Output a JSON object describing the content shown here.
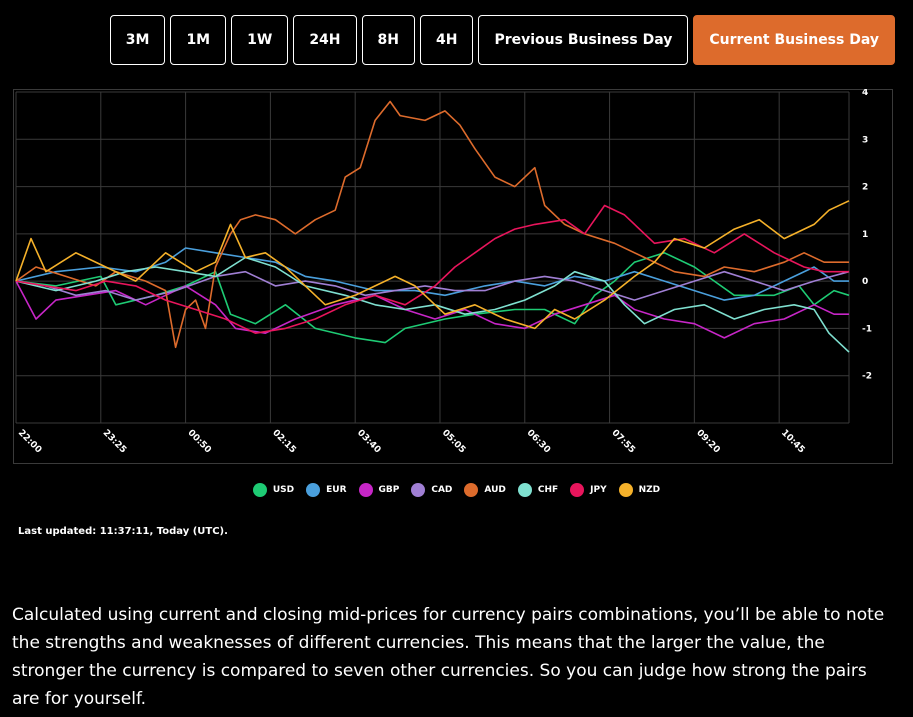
{
  "tabs": [
    {
      "label": "3M",
      "active": false
    },
    {
      "label": "1M",
      "active": false
    },
    {
      "label": "1W",
      "active": false
    },
    {
      "label": "24H",
      "active": false
    },
    {
      "label": "8H",
      "active": false
    },
    {
      "label": "4H",
      "active": false
    },
    {
      "label": "Previous Business Day",
      "active": false
    },
    {
      "label": "Current Business Day",
      "active": true
    }
  ],
  "colors": {
    "accent": "#dd6b2c",
    "background": "#000000",
    "grid": "#3a3a3a"
  },
  "chart_data": {
    "type": "line",
    "title": "",
    "xlabel": "",
    "ylabel": "",
    "x_tick_labels": [
      "22:00",
      "23:25",
      "00:50",
      "02:15",
      "03:40",
      "05:05",
      "06:30",
      "07:55",
      "09:20",
      "10:45"
    ],
    "x_range_minutes": [
      0,
      835
    ],
    "ylim": [
      -3,
      4
    ],
    "y_ticks": [
      4,
      3,
      2,
      1,
      0,
      -1,
      -2
    ],
    "grid": true,
    "legend_position": "bottom",
    "series": [
      {
        "name": "USD",
        "color": "#1ecb74",
        "points": [
          [
            0,
            0
          ],
          [
            40,
            -0.1
          ],
          [
            85,
            0.1
          ],
          [
            100,
            -0.5
          ],
          [
            140,
            -0.3
          ],
          [
            170,
            -0.1
          ],
          [
            200,
            0.2
          ],
          [
            215,
            -0.7
          ],
          [
            240,
            -0.9
          ],
          [
            270,
            -0.5
          ],
          [
            300,
            -1
          ],
          [
            340,
            -1.2
          ],
          [
            370,
            -1.3
          ],
          [
            390,
            -1
          ],
          [
            430,
            -0.8
          ],
          [
            460,
            -0.7
          ],
          [
            500,
            -0.6
          ],
          [
            530,
            -0.6
          ],
          [
            560,
            -0.9
          ],
          [
            580,
            -0.3
          ],
          [
            600,
            0
          ],
          [
            620,
            0.4
          ],
          [
            650,
            0.6
          ],
          [
            680,
            0.3
          ],
          [
            700,
            0
          ],
          [
            720,
            -0.3
          ],
          [
            760,
            -0.3
          ],
          [
            785,
            -0.1
          ],
          [
            800,
            -0.5
          ],
          [
            820,
            -0.2
          ],
          [
            835,
            -0.3
          ]
        ]
      },
      {
        "name": "EUR",
        "color": "#4a9fdc",
        "points": [
          [
            0,
            0
          ],
          [
            40,
            0.2
          ],
          [
            85,
            0.3
          ],
          [
            120,
            0.2
          ],
          [
            150,
            0.4
          ],
          [
            170,
            0.7
          ],
          [
            200,
            0.6
          ],
          [
            230,
            0.5
          ],
          [
            260,
            0.4
          ],
          [
            290,
            0.1
          ],
          [
            320,
            0
          ],
          [
            360,
            -0.2
          ],
          [
            400,
            -0.2
          ],
          [
            430,
            -0.3
          ],
          [
            470,
            -0.1
          ],
          [
            500,
            0
          ],
          [
            530,
            -0.1
          ],
          [
            560,
            0.1
          ],
          [
            590,
            0
          ],
          [
            620,
            0.2
          ],
          [
            650,
            0
          ],
          [
            680,
            -0.2
          ],
          [
            710,
            -0.4
          ],
          [
            740,
            -0.3
          ],
          [
            770,
            0
          ],
          [
            800,
            0.3
          ],
          [
            820,
            0
          ],
          [
            835,
            0
          ]
        ]
      },
      {
        "name": "GBP",
        "color": "#c726c7",
        "points": [
          [
            0,
            0
          ],
          [
            20,
            -0.8
          ],
          [
            40,
            -0.4
          ],
          [
            70,
            -0.3
          ],
          [
            100,
            -0.2
          ],
          [
            130,
            -0.5
          ],
          [
            150,
            -0.3
          ],
          [
            170,
            -0.1
          ],
          [
            200,
            -0.5
          ],
          [
            220,
            -1
          ],
          [
            250,
            -1.1
          ],
          [
            280,
            -0.8
          ],
          [
            320,
            -0.5
          ],
          [
            360,
            -0.3
          ],
          [
            390,
            -0.6
          ],
          [
            420,
            -0.8
          ],
          [
            450,
            -0.6
          ],
          [
            480,
            -0.9
          ],
          [
            510,
            -1
          ],
          [
            540,
            -0.7
          ],
          [
            570,
            -0.5
          ],
          [
            600,
            -0.3
          ],
          [
            620,
            -0.6
          ],
          [
            650,
            -0.8
          ],
          [
            680,
            -0.9
          ],
          [
            710,
            -1.2
          ],
          [
            740,
            -0.9
          ],
          [
            770,
            -0.8
          ],
          [
            800,
            -0.5
          ],
          [
            820,
            -0.7
          ],
          [
            835,
            -0.7
          ]
        ]
      },
      {
        "name": "CAD",
        "color": "#a07fd4",
        "points": [
          [
            0,
            0
          ],
          [
            30,
            -0.1
          ],
          [
            60,
            -0.3
          ],
          [
            90,
            -0.2
          ],
          [
            120,
            -0.4
          ],
          [
            160,
            -0.2
          ],
          [
            200,
            0.1
          ],
          [
            230,
            0.2
          ],
          [
            260,
            -0.1
          ],
          [
            290,
            0
          ],
          [
            320,
            -0.1
          ],
          [
            350,
            -0.3
          ],
          [
            380,
            -0.2
          ],
          [
            410,
            -0.1
          ],
          [
            440,
            -0.2
          ],
          [
            470,
            -0.2
          ],
          [
            500,
            0
          ],
          [
            530,
            0.1
          ],
          [
            560,
            0
          ],
          [
            590,
            -0.2
          ],
          [
            620,
            -0.4
          ],
          [
            650,
            -0.2
          ],
          [
            680,
            0
          ],
          [
            710,
            0.2
          ],
          [
            740,
            0
          ],
          [
            770,
            -0.2
          ],
          [
            800,
            0
          ],
          [
            835,
            0.2
          ]
        ]
      },
      {
        "name": "AUD",
        "color": "#dd6b2c",
        "points": [
          [
            0,
            0
          ],
          [
            20,
            0.3
          ],
          [
            50,
            0.1
          ],
          [
            80,
            -0.1
          ],
          [
            100,
            0.2
          ],
          [
            130,
            0
          ],
          [
            150,
            -0.2
          ],
          [
            160,
            -1.4
          ],
          [
            170,
            -0.6
          ],
          [
            180,
            -0.4
          ],
          [
            190,
            -1
          ],
          [
            200,
            0.3
          ],
          [
            215,
            1
          ],
          [
            225,
            1.3
          ],
          [
            240,
            1.4
          ],
          [
            260,
            1.3
          ],
          [
            280,
            1
          ],
          [
            300,
            1.3
          ],
          [
            320,
            1.5
          ],
          [
            330,
            2.2
          ],
          [
            345,
            2.4
          ],
          [
            360,
            3.4
          ],
          [
            375,
            3.8
          ],
          [
            385,
            3.5
          ],
          [
            410,
            3.4
          ],
          [
            430,
            3.6
          ],
          [
            445,
            3.3
          ],
          [
            460,
            2.8
          ],
          [
            480,
            2.2
          ],
          [
            500,
            2
          ],
          [
            520,
            2.4
          ],
          [
            530,
            1.6
          ],
          [
            550,
            1.2
          ],
          [
            570,
            1
          ],
          [
            600,
            0.8
          ],
          [
            630,
            0.5
          ],
          [
            660,
            0.2
          ],
          [
            690,
            0.1
          ],
          [
            710,
            0.3
          ],
          [
            740,
            0.2
          ],
          [
            770,
            0.4
          ],
          [
            790,
            0.6
          ],
          [
            810,
            0.4
          ],
          [
            835,
            0.4
          ]
        ]
      },
      {
        "name": "CHF",
        "color": "#7fe0d0",
        "points": [
          [
            0,
            0
          ],
          [
            40,
            -0.2
          ],
          [
            80,
            0
          ],
          [
            110,
            0.2
          ],
          [
            140,
            0.3
          ],
          [
            170,
            0.2
          ],
          [
            200,
            0.1
          ],
          [
            230,
            0.5
          ],
          [
            260,
            0.3
          ],
          [
            290,
            -0.1
          ],
          [
            330,
            -0.3
          ],
          [
            360,
            -0.5
          ],
          [
            390,
            -0.6
          ],
          [
            420,
            -0.5
          ],
          [
            450,
            -0.7
          ],
          [
            480,
            -0.6
          ],
          [
            510,
            -0.4
          ],
          [
            540,
            -0.1
          ],
          [
            560,
            0.2
          ],
          [
            590,
            0
          ],
          [
            610,
            -0.5
          ],
          [
            630,
            -0.9
          ],
          [
            660,
            -0.6
          ],
          [
            690,
            -0.5
          ],
          [
            720,
            -0.8
          ],
          [
            750,
            -0.6
          ],
          [
            780,
            -0.5
          ],
          [
            800,
            -0.6
          ],
          [
            815,
            -1.1
          ],
          [
            835,
            -1.5
          ]
        ]
      },
      {
        "name": "JPY",
        "color": "#e8155c",
        "points": [
          [
            0,
            0
          ],
          [
            30,
            -0.1
          ],
          [
            60,
            -0.2
          ],
          [
            90,
            0
          ],
          [
            120,
            -0.1
          ],
          [
            150,
            -0.4
          ],
          [
            180,
            -0.6
          ],
          [
            210,
            -0.8
          ],
          [
            240,
            -1.1
          ],
          [
            270,
            -1
          ],
          [
            300,
            -0.8
          ],
          [
            330,
            -0.5
          ],
          [
            360,
            -0.3
          ],
          [
            390,
            -0.5
          ],
          [
            420,
            -0.1
          ],
          [
            440,
            0.3
          ],
          [
            460,
            0.6
          ],
          [
            480,
            0.9
          ],
          [
            500,
            1.1
          ],
          [
            520,
            1.2
          ],
          [
            550,
            1.3
          ],
          [
            570,
            1
          ],
          [
            590,
            1.6
          ],
          [
            610,
            1.4
          ],
          [
            640,
            0.8
          ],
          [
            670,
            0.9
          ],
          [
            700,
            0.6
          ],
          [
            730,
            1
          ],
          [
            760,
            0.6
          ],
          [
            790,
            0.3
          ],
          [
            810,
            0.2
          ],
          [
            835,
            0.2
          ]
        ]
      },
      {
        "name": "NZD",
        "color": "#f5b12a",
        "points": [
          [
            0,
            0
          ],
          [
            15,
            0.9
          ],
          [
            30,
            0.2
          ],
          [
            60,
            0.6
          ],
          [
            90,
            0.3
          ],
          [
            120,
            0
          ],
          [
            150,
            0.6
          ],
          [
            180,
            0.2
          ],
          [
            200,
            0.4
          ],
          [
            215,
            1.2
          ],
          [
            230,
            0.5
          ],
          [
            250,
            0.6
          ],
          [
            270,
            0.3
          ],
          [
            290,
            -0.1
          ],
          [
            310,
            -0.5
          ],
          [
            340,
            -0.3
          ],
          [
            360,
            -0.1
          ],
          [
            380,
            0.1
          ],
          [
            400,
            -0.1
          ],
          [
            430,
            -0.7
          ],
          [
            460,
            -0.5
          ],
          [
            490,
            -0.8
          ],
          [
            520,
            -1
          ],
          [
            540,
            -0.6
          ],
          [
            560,
            -0.8
          ],
          [
            590,
            -0.4
          ],
          [
            620,
            0.1
          ],
          [
            640,
            0.4
          ],
          [
            660,
            0.9
          ],
          [
            690,
            0.7
          ],
          [
            720,
            1.1
          ],
          [
            745,
            1.3
          ],
          [
            770,
            0.9
          ],
          [
            800,
            1.2
          ],
          [
            815,
            1.5
          ],
          [
            835,
            1.7
          ]
        ]
      }
    ]
  },
  "last_updated": "Last updated: 11:37:11, Today (UTC).",
  "description": "Calculated using current and closing mid-prices for currency pairs combinations, you’ll be able to note the strengths and weaknesses of different currencies. This means that the larger the value, the stronger the currency is compared to seven other currencies. So you can judge how strong the pairs are for yourself."
}
